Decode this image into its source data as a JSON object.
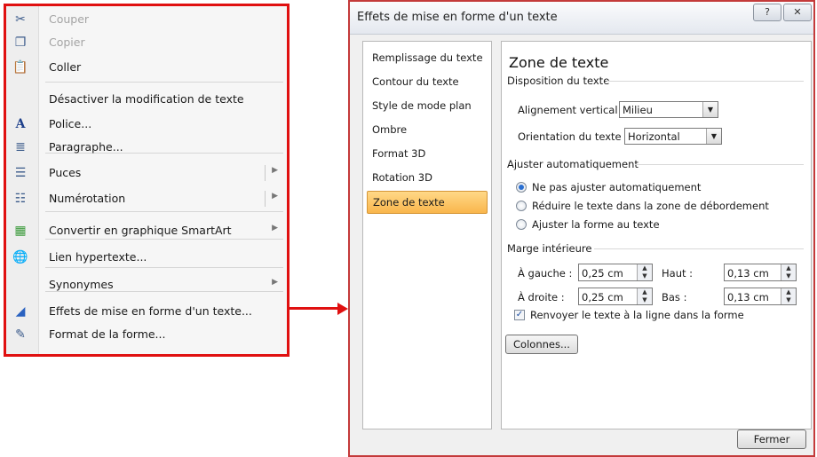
{
  "context_menu": {
    "items": [
      {
        "label": "Couper",
        "icon": "scissors-icon",
        "glyph": "✂",
        "disabled": true
      },
      {
        "label": "Copier",
        "icon": "copy-icon",
        "glyph": "❐",
        "disabled": true
      },
      {
        "label": "Coller",
        "icon": "paste-icon",
        "glyph": "📋",
        "disabled": false
      },
      {
        "label": "Désactiver la modification de texte",
        "icon": "",
        "glyph": "",
        "disabled": false
      },
      {
        "label": "Police...",
        "icon": "font-icon",
        "glyph": "A",
        "disabled": false
      },
      {
        "label": "Paragraphe...",
        "icon": "paragraph-icon",
        "glyph": "≣",
        "disabled": false
      },
      {
        "label": "Puces",
        "icon": "bullets-icon",
        "glyph": "☰",
        "disabled": false,
        "submenu": true,
        "split": true
      },
      {
        "label": "Numérotation",
        "icon": "numbering-icon",
        "glyph": "☷",
        "disabled": false,
        "submenu": true,
        "split": true
      },
      {
        "label": "Convertir en graphique SmartArt",
        "icon": "smartart-icon",
        "glyph": "▦",
        "disabled": false,
        "submenu": true
      },
      {
        "label": "Lien hypertexte...",
        "icon": "hyperlink-icon",
        "glyph": "🌐",
        "disabled": false
      },
      {
        "label": "Synonymes",
        "icon": "",
        "glyph": "",
        "disabled": false,
        "submenu": true
      },
      {
        "label": "Effets de mise en forme d'un texte...",
        "icon": "text-effects-icon",
        "glyph": "◢",
        "disabled": false
      },
      {
        "label": "Format de la forme...",
        "icon": "shape-format-icon",
        "glyph": "✎",
        "disabled": false
      }
    ]
  },
  "dialog": {
    "title": "Effets de mise en forme d'un texte",
    "help_glyph": "?",
    "close_glyph": "✕",
    "nav": [
      "Remplissage du texte",
      "Contour du texte",
      "Style de mode plan",
      "Ombre",
      "Format 3D",
      "Rotation 3D",
      "Zone de texte"
    ],
    "selected_nav": "Zone de texte",
    "panel": {
      "heading": "Zone de texte",
      "layout_section": "Disposition du texte",
      "vertical_label": "Alignement vertical :",
      "vertical_value": "Milieu",
      "orientation_label": "Orientation du texte :",
      "orientation_value": "Horizontal",
      "autofit_section": "Ajuster automatiquement",
      "autofit_options": [
        "Ne pas ajuster automatiquement",
        "Réduire le texte dans la zone de débordement",
        "Ajuster la forme au texte"
      ],
      "autofit_selected": 0,
      "margin_section": "Marge intérieure",
      "left_label": "À gauche :",
      "left_value": "0,25 cm",
      "top_label": "Haut :",
      "top_value": "0,13 cm",
      "right_label": "À droite :",
      "right_value": "0,25 cm",
      "bottom_label": "Bas :",
      "bottom_value": "0,13 cm",
      "wrap_label": "Renvoyer le texte à la ligne dans la forme",
      "wrap_checked": true,
      "columns_button": "Colonnes..."
    },
    "close_button": "Fermer"
  },
  "colors": {
    "highlight_border": "#e01010",
    "selected_nav": "#f9b64c"
  }
}
